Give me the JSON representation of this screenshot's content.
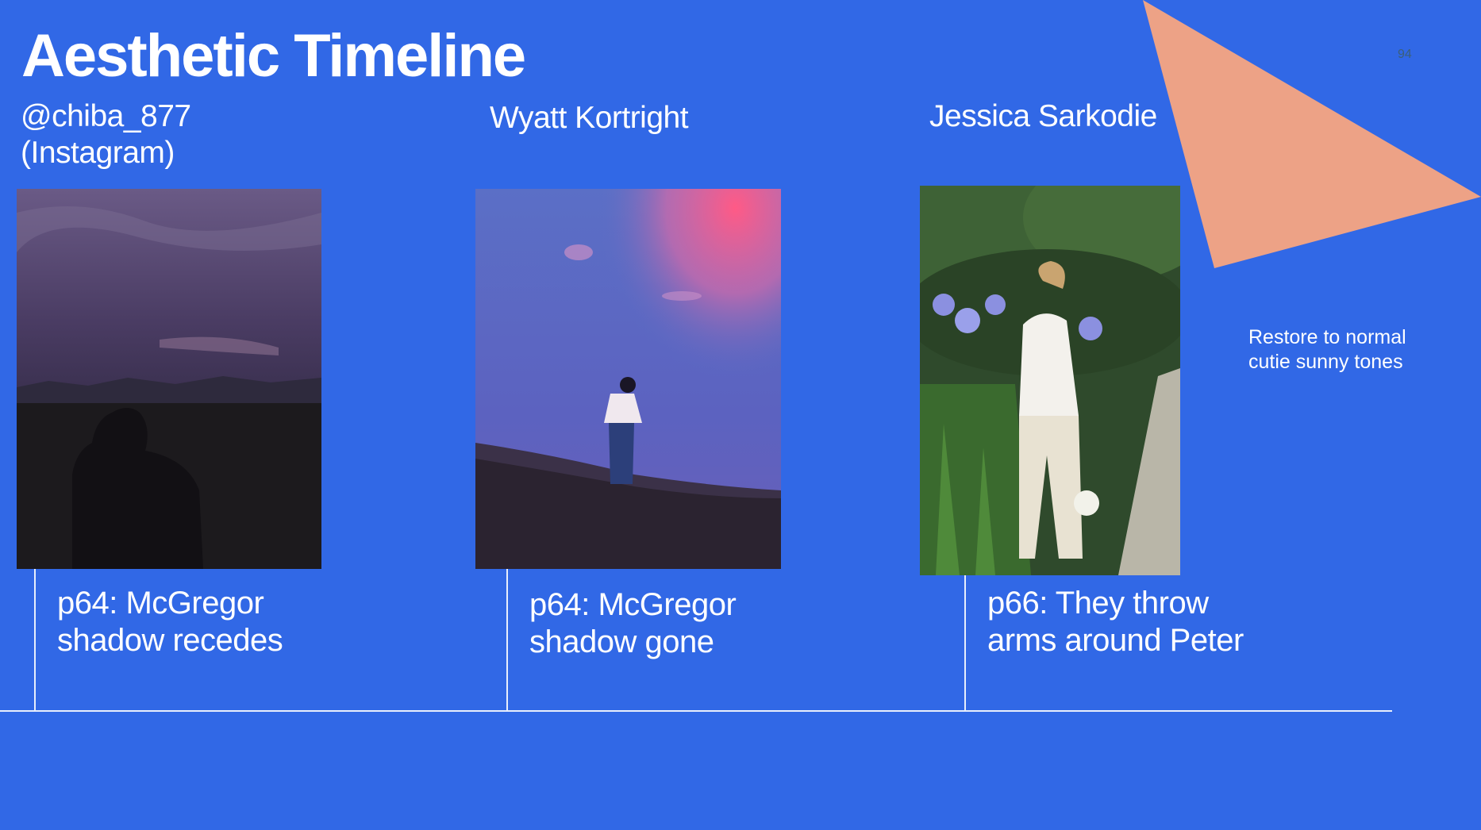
{
  "slide": {
    "title": "Aesthetic Timeline",
    "page_number": "94",
    "note_line1": "Restore to normal",
    "note_line2": "cutie sunny tones"
  },
  "columns": [
    {
      "credit_line1": "@chiba_877",
      "credit_line2": "(Instagram)",
      "caption_line1": "p64: McGregor",
      "caption_line2": "shadow recedes"
    },
    {
      "credit_line1": "Wyatt Kortright",
      "caption_line1": "p64: McGregor",
      "caption_line2": "shadow gone"
    },
    {
      "credit_line1": "Jessica Sarkodie",
      "caption_line1": "p66: They throw",
      "caption_line2": "arms around Peter"
    }
  ],
  "colors": {
    "background": "#3168E6",
    "accent_triangle": "#EDA286",
    "line": "#E8EEFC"
  }
}
